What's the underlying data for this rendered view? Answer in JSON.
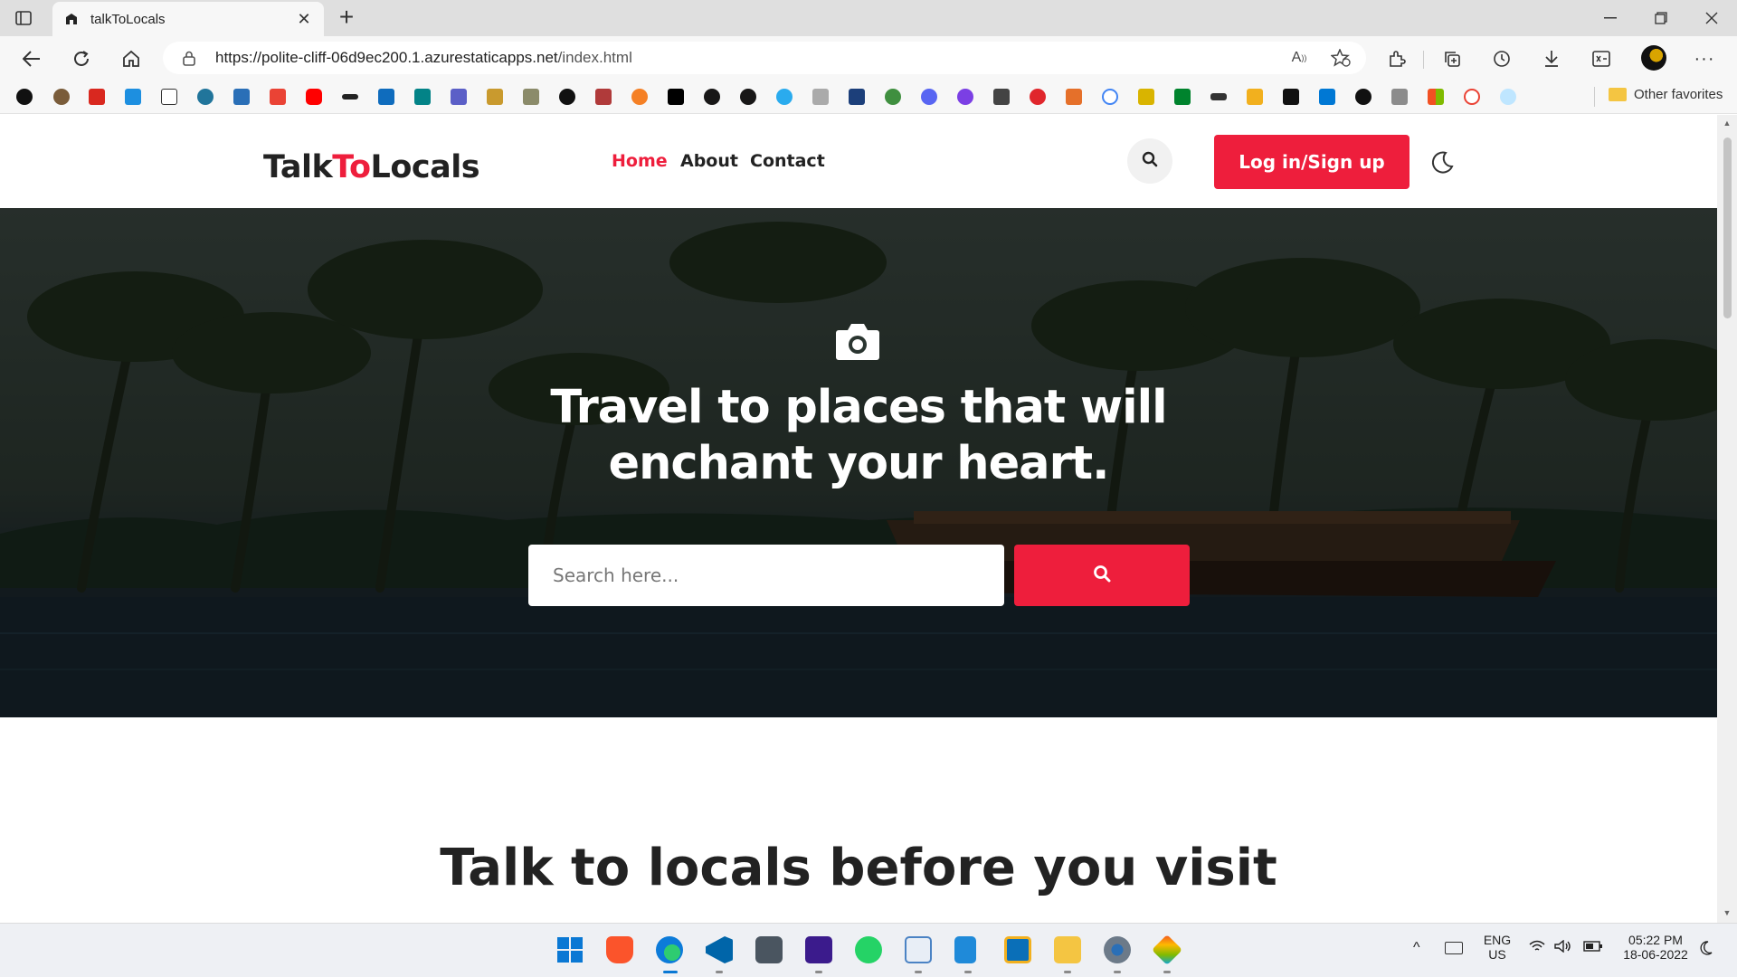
{
  "browser": {
    "tab": {
      "title": "talkToLocals"
    },
    "url": {
      "host": "https://polite-cliff-06d9ec200.1.azurestaticapps.net",
      "path": "/index.html"
    },
    "favorites": {
      "other_label": "Other favorites"
    }
  },
  "site": {
    "brand": {
      "part1": "Talk",
      "part2": "To",
      "part3": "Locals"
    },
    "nav": {
      "home": "Home",
      "about": "About",
      "contact": "Contact"
    },
    "login_label": "Log in/Sign up",
    "hero": {
      "title": "Travel to places that will enchant your heart.",
      "search_placeholder": "Search here..."
    },
    "section_title": "Talk to locals before you visit",
    "accent_color": "#ee1e3c"
  },
  "taskbar": {
    "lang_line1": "ENG",
    "lang_line2": "US",
    "time": "05:22 PM",
    "date": "18-06-2022"
  }
}
